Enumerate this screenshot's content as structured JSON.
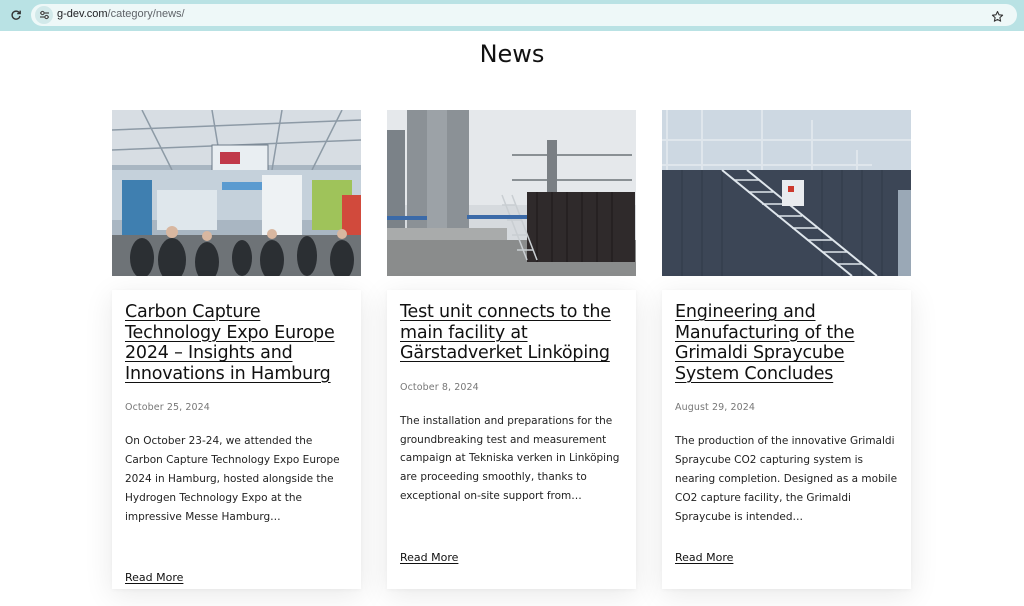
{
  "browser": {
    "url_domain": "g-dev.com",
    "url_path": "/category/news/",
    "icons": [
      "reload-icon",
      "site-info-icon",
      "bookmark-star-icon"
    ]
  },
  "page": {
    "title": "News"
  },
  "posts": [
    {
      "title": "Carbon Capture Technology Expo Europe 2024 – Insights and Innovations in Hamburg",
      "date": "October 25, 2024",
      "excerpt": "On October 23-24, we attended the Carbon Capture Technology Expo Europe 2024 in Hamburg, hosted alongside the Hydrogen Technology Expo at the impressive Messe Hamburg…",
      "read_more": "Read More"
    },
    {
      "title": "Test unit connects to the main facility at Gärstadverket Linköping",
      "date": "October 8, 2024",
      "excerpt": "The installation and preparations for the groundbreaking test and measurement campaign at Tekniska verken in Linköping are proceeding smoothly, thanks to exceptional on-site support from…",
      "read_more": "Read More"
    },
    {
      "title": "Engineering and Manufacturing of the Grimaldi Spraycube System Concludes",
      "date": "August 29, 2024",
      "excerpt": "The production of the innovative Grimaldi Spraycube CO2 capturing system is nearing completion. Designed as a mobile CO2 capture facility, the Grimaldi Spraycube is intended…",
      "read_more": "Read More"
    }
  ],
  "colors": {
    "browser_bar": "#b9e2e4",
    "url_box": "#eef8f8",
    "text": "#111111",
    "date": "#777777"
  }
}
